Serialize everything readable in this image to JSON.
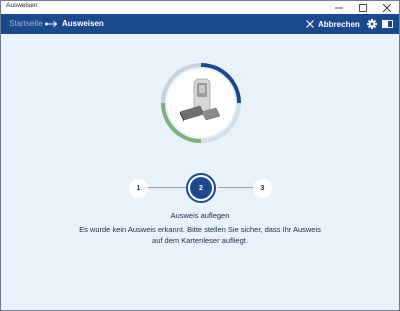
{
  "window": {
    "title": "Ausweisen"
  },
  "header": {
    "breadcrumb_home": "Startseite",
    "breadcrumb_current": "Ausweisen",
    "cancel_label": "Abbrechen"
  },
  "steps": [
    {
      "number": "1",
      "state": "pending"
    },
    {
      "number": "2",
      "state": "active"
    },
    {
      "number": "3",
      "state": "pending"
    }
  ],
  "message": {
    "title": "Ausweis auflegen",
    "line1": "Es wurde kein Ausweis erkannt. Bitte stellen Sie sicher, dass Ihr Ausweis",
    "line2": "auf dem Kartenleser aufliegt."
  },
  "colors": {
    "header_bg": "#1a4a8d",
    "content_bg": "#e9f2fb",
    "progress_blue": "#1a4a8d",
    "progress_green": "#7fb27a"
  },
  "icons": {
    "separator": "arrow-right-icon",
    "cancel": "close-icon",
    "settings": "gear-icon",
    "help": "manual-icon",
    "hero": "card-reader-icon"
  }
}
